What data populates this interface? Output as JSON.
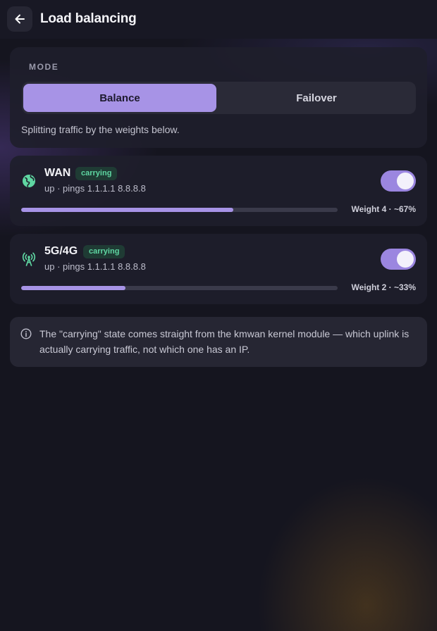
{
  "header": {
    "title": "Load balancing",
    "back_icon": "arrow-left-icon"
  },
  "mode": {
    "label": "MODE",
    "options": [
      "Balance",
      "Failover"
    ],
    "selected": "Balance",
    "description": "Splitting traffic by the weights below."
  },
  "uplinks": [
    {
      "name": "WAN",
      "icon": "globe-icon",
      "badge": "carrying",
      "status": "up · pings 1.1.1.1 8.8.8.8",
      "enabled": true,
      "weight_fraction": 0.67,
      "weight_label": "Weight 4 · ~67%"
    },
    {
      "name": "5G/4G",
      "icon": "cell-tower-icon",
      "badge": "carrying",
      "status": "up · pings 1.1.1.1 8.8.8.8",
      "enabled": true,
      "weight_fraction": 0.33,
      "weight_label": "Weight 2 · ~33%"
    }
  ],
  "info": {
    "icon": "info-icon",
    "text": "The \"carrying\" state comes straight from the kmwan kernel module — which uplink is actually carrying traffic, not which one has an IP."
  },
  "colors": {
    "accent": "#a793e6",
    "badge_text": "#5fd6a2",
    "badge_bg": "#1f3b34",
    "background": "#15151f"
  }
}
